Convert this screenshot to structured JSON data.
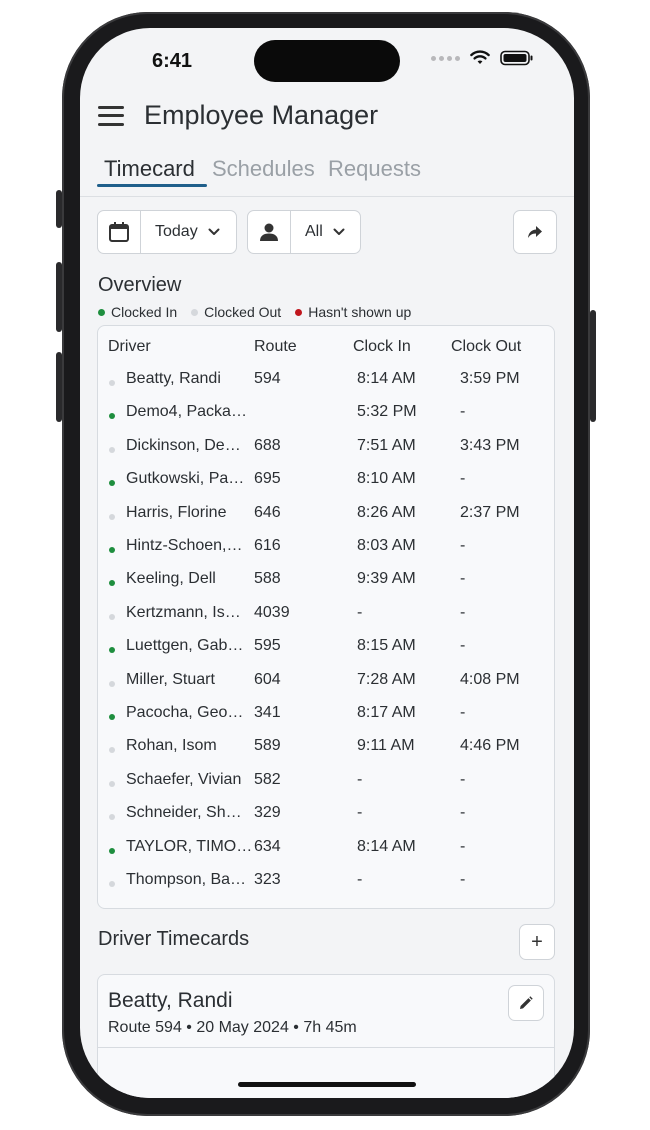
{
  "status": {
    "time": "6:41"
  },
  "app": {
    "title": "Employee Manager"
  },
  "tabs": [
    {
      "label": "Timecard",
      "active": true
    },
    {
      "label": "Schedules",
      "active": false
    },
    {
      "label": "Requests",
      "active": false
    }
  ],
  "filters": {
    "date": {
      "icon": "calendar-icon",
      "value": "Today"
    },
    "person": {
      "icon": "person-icon",
      "value": "All"
    },
    "share_icon": "share-arrow-icon"
  },
  "overview": {
    "title": "Overview",
    "legend": [
      {
        "label": "Clocked In",
        "color": "#1e8e3e"
      },
      {
        "label": "Clocked Out",
        "color": "#d5d8dc"
      },
      {
        "label": "Hasn't shown up",
        "color": "#c0161d"
      }
    ],
    "columns": [
      "Driver",
      "Route",
      "Clock In",
      "Clock Out"
    ],
    "rows": [
      {
        "status": "out",
        "driver": "Beatty, Randi",
        "route": "594",
        "clock_in": "8:14 AM",
        "clock_out": "3:59 PM"
      },
      {
        "status": "in",
        "driver": "Demo4, Packa…",
        "route": "",
        "clock_in": "5:32 PM",
        "clock_out": "-"
      },
      {
        "status": "out",
        "driver": "Dickinson, De…",
        "route": "688",
        "clock_in": "7:51 AM",
        "clock_out": "3:43 PM"
      },
      {
        "status": "in",
        "driver": "Gutkowski, Pa…",
        "route": "695",
        "clock_in": "8:10 AM",
        "clock_out": "-"
      },
      {
        "status": "out",
        "driver": "Harris, Florine",
        "route": "646",
        "clock_in": "8:26 AM",
        "clock_out": "2:37 PM"
      },
      {
        "status": "in",
        "driver": "Hintz-Schoen,…",
        "route": "616",
        "clock_in": "8:03 AM",
        "clock_out": "-"
      },
      {
        "status": "in",
        "driver": "Keeling, Dell",
        "route": "588",
        "clock_in": "9:39 AM",
        "clock_out": "-"
      },
      {
        "status": "out",
        "driver": "Kertzmann, Is…",
        "route": "4039",
        "clock_in": "-",
        "clock_out": "-"
      },
      {
        "status": "in",
        "driver": "Luettgen, Gab…",
        "route": "595",
        "clock_in": "8:15 AM",
        "clock_out": "-"
      },
      {
        "status": "out",
        "driver": "Miller, Stuart",
        "route": "604",
        "clock_in": "7:28 AM",
        "clock_out": "4:08 PM"
      },
      {
        "status": "in",
        "driver": "Pacocha, Geo…",
        "route": "341",
        "clock_in": "8:17 AM",
        "clock_out": "-"
      },
      {
        "status": "out",
        "driver": "Rohan, Isom",
        "route": "589",
        "clock_in": "9:11 AM",
        "clock_out": "4:46 PM"
      },
      {
        "status": "out",
        "driver": "Schaefer, Vivian",
        "route": "582",
        "clock_in": "-",
        "clock_out": "-"
      },
      {
        "status": "out",
        "driver": "Schneider, Sh…",
        "route": "329",
        "clock_in": "-",
        "clock_out": "-"
      },
      {
        "status": "in",
        "driver": "TAYLOR, TIMO…",
        "route": "634",
        "clock_in": "8:14 AM",
        "clock_out": "-"
      },
      {
        "status": "out",
        "driver": "Thompson, Ba…",
        "route": "323",
        "clock_in": "-",
        "clock_out": "-"
      }
    ]
  },
  "timecards": {
    "title": "Driver Timecards",
    "add_label": "+",
    "cards": [
      {
        "name": "Beatty, Randi",
        "meta": "Route 594 •  20 May 2024 • 7h 45m"
      }
    ]
  },
  "colors": {
    "accent": "#1f5f8b",
    "clocked_in": "#1e8e3e",
    "clocked_out": "#d5d8dc",
    "no_show": "#c0161d"
  }
}
